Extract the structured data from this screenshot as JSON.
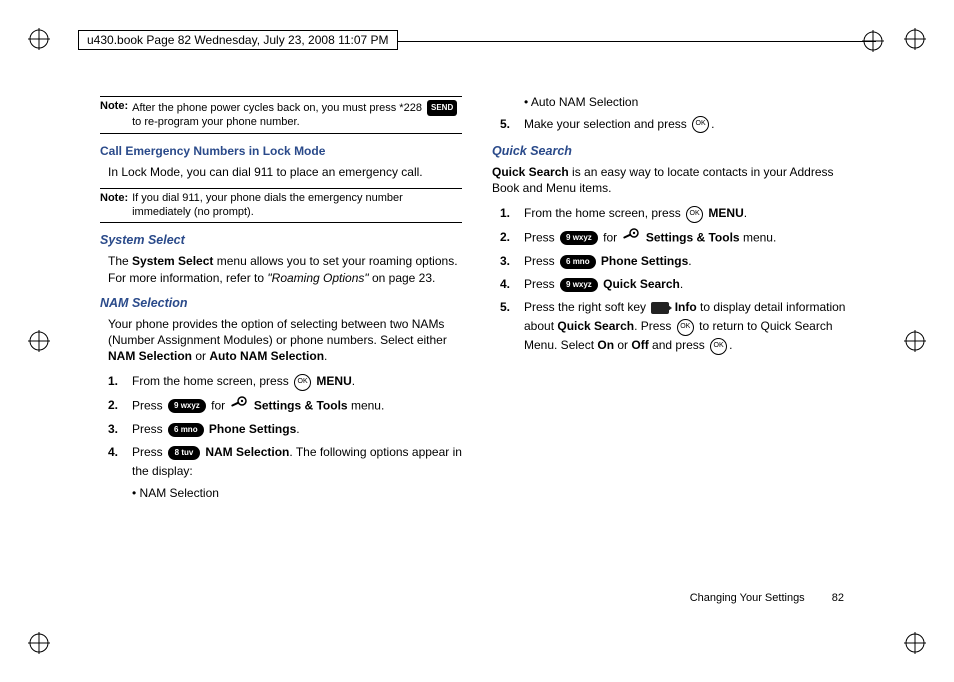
{
  "header": {
    "text": "u430.book  Page 82  Wednesday, July 23, 2008  11:07 PM"
  },
  "left": {
    "note1_label": "Note:",
    "note1_a": "After the phone power cycles back on, you must press *228 ",
    "note1_b": " to re-program your phone number.",
    "key_send": "SEND",
    "h1": "Call Emergency Numbers in Lock Mode",
    "p1": "In Lock Mode, you can dial 911 to place an emergency call.",
    "note2_label": "Note:",
    "note2": "If you dial 911, your phone dials the emergency number immediately (no prompt).",
    "h2": "System Select",
    "p2a": "The ",
    "p2b": "System Select",
    "p2c": " menu allows you to set your roaming options. For more information, refer to ",
    "p2d": "\"Roaming Options\"",
    "p2e": "  on page 23.",
    "h3": "NAM Selection",
    "p3a": "Your phone provides the option of selecting between two NAMs (Number Assignment Modules) or phone numbers. Select either ",
    "p3b": "NAM Selection",
    "p3c": " or ",
    "p3d": "Auto NAM Selection",
    "p3e": ".",
    "s1n": "1.",
    "s1a": "From the home screen, press ",
    "s1b": " MENU",
    "s1c": ".",
    "s2n": "2.",
    "s2a": "Press ",
    "s2b": " for ",
    "s2c": " Settings & Tools",
    "s2d": " menu.",
    "s3n": "3.",
    "s3a": "Press ",
    "s3b": " Phone Settings",
    "s3c": ".",
    "s4n": "4.",
    "s4a": "Press ",
    "s4b": " NAM Selection",
    "s4c": ". The following options appear in the display:",
    "key9": "9 wxyz",
    "key6": "6 mno",
    "key8": "8 tuv",
    "ok": "OK",
    "bul1": "NAM Selection"
  },
  "right": {
    "bul2": "Auto NAM Selection",
    "s5n": "5.",
    "s5a": "Make your selection and press ",
    "s5b": ".",
    "h1": "Quick Search",
    "p1a": "Quick Search",
    "p1b": " is an easy way to locate contacts in your Address Book and Menu items.",
    "r1n": "1.",
    "r1a": "From the home screen, press ",
    "r1b": " MENU",
    "r1c": ".",
    "r2n": "2.",
    "r2a": "Press ",
    "r2b": " for ",
    "r2c": " Settings & Tools",
    "r2d": " menu.",
    "r3n": "3.",
    "r3a": "Press ",
    "r3b": " Phone Settings",
    "r3c": ".",
    "r4n": "4.",
    "r4a": "Press ",
    "r4b": " Quick Search",
    "r4c": ".",
    "r5n": "5.",
    "r5a": "Press the right soft key ",
    "r5b": " Info",
    "r5c": " to display detail information about ",
    "r5d": "Quick Search",
    "r5e": ". Press ",
    "r5f": " to return to Quick Search Menu. Select ",
    "r5g": "On",
    "r5h": " or ",
    "r5i": "Off",
    "r5j": " and press ",
    "r5k": ".",
    "key9": "9 wxyz",
    "key6": "6 mno",
    "ok": "OK"
  },
  "footer": {
    "section": "Changing Your Settings",
    "page": "82"
  }
}
